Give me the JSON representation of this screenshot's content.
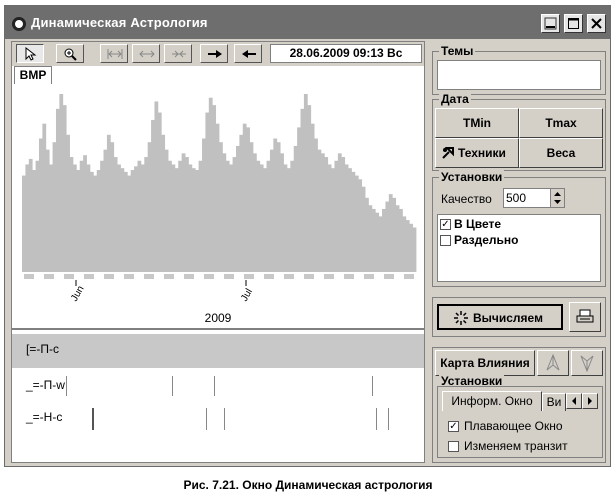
{
  "window": {
    "title": "Динамическая Астрология"
  },
  "toolbar": {
    "datetime": "28.06.2009  09:13 Вс",
    "tab_label": "BMP"
  },
  "chart_data": {
    "type": "bar",
    "x_tick_labels": [
      "Jun",
      "Jul"
    ],
    "xlabel": "2009",
    "grid": false,
    "color": "#c0c0c0",
    "values": [
      52,
      58,
      61,
      55,
      60,
      72,
      80,
      66,
      58,
      70,
      88,
      96,
      90,
      74,
      62,
      58,
      55,
      60,
      63,
      58,
      54,
      52,
      55,
      60,
      66,
      74,
      70,
      62,
      58,
      56,
      54,
      52,
      55,
      57,
      60,
      58,
      62,
      70,
      82,
      92,
      86,
      74,
      66,
      60,
      58,
      56,
      60,
      64,
      62,
      58,
      56,
      55,
      60,
      72,
      86,
      94,
      90,
      80,
      70,
      64,
      60,
      58,
      62,
      68,
      74,
      80,
      78,
      70,
      64,
      60,
      58,
      56,
      60,
      66,
      72,
      70,
      64,
      58,
      56,
      60,
      68,
      78,
      88,
      96,
      90,
      80,
      72,
      66,
      64,
      62,
      58,
      56,
      60,
      64,
      62,
      58,
      56,
      54,
      52,
      50,
      46,
      40,
      36,
      34,
      32,
      30,
      34,
      38,
      42,
      40,
      36,
      34,
      30,
      28,
      26,
      24
    ]
  },
  "lower_rows": [
    {
      "label": "[=-П-с"
    },
    {
      "label": "_=-П-w"
    },
    {
      "label": "_=-Н-с"
    }
  ],
  "right": {
    "themes_label": "Темы",
    "date_label": "Дата",
    "tmin_label": "TMin",
    "tmax_label": "Tmax",
    "techniques_label": "Техники",
    "weights_label": "Веса",
    "settings_label": "Установки",
    "quality_label": "Качество",
    "quality_value": "500",
    "in_color_label": "В Цвете",
    "separately_label": "Раздельно",
    "compute_label": "Вычисляем",
    "influence_map_label": "Карта Влияния",
    "settings2_label": "Установки",
    "tab_info_label": "Информ. Окно",
    "tab_vi_label": "Ви",
    "floating_window_label": "Плавающее Окно",
    "change_transit_label": "Изменяем транзит"
  },
  "caption": {
    "text": "Рис. 7.21. Окно Динамическая астрология"
  }
}
